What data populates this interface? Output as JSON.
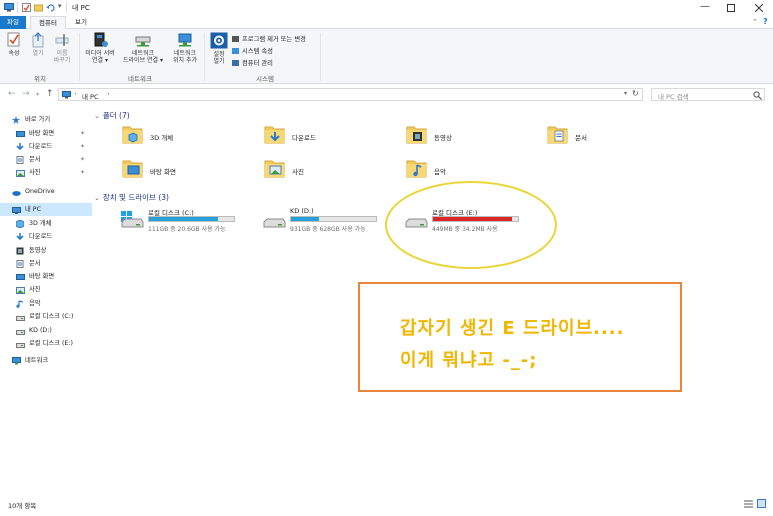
{
  "window": {
    "title": "내 PC",
    "controls": [
      "minimize",
      "maximize",
      "close"
    ]
  },
  "ribbon_tabs": [
    {
      "label": "파일",
      "active": true
    },
    {
      "label": "컴퓨터",
      "active": false
    },
    {
      "label": "보기",
      "active": false
    }
  ],
  "ribbon": {
    "location_group": {
      "label": "위치",
      "buttons": [
        {
          "label1": "속성",
          "label2": ""
        },
        {
          "label1": "열기",
          "label2": ""
        },
        {
          "label1": "이름",
          "label2": "바꾸기"
        }
      ]
    },
    "network_group": {
      "label": "네트워크",
      "buttons": [
        {
          "label1": "미디어 서버",
          "label2": "연결 ▾"
        },
        {
          "label1": "네트워크",
          "label2": "드라이브 연결 ▾"
        },
        {
          "label1": "네트워크",
          "label2": "위치 추가"
        }
      ]
    },
    "system_group": {
      "label": "시스템",
      "big_button": {
        "label1": "설정",
        "label2": "열기"
      },
      "items": [
        "프로그램 제거 또는 변경",
        "시스템 속성",
        "컴퓨터 관리"
      ]
    }
  },
  "address_bar": {
    "path": "내 PC",
    "separator": "›",
    "search_placeholder": "내 PC 검색"
  },
  "sidebar": {
    "items": [
      {
        "label": "바로 가기",
        "icon": "star-icon",
        "pinned": false
      },
      {
        "label": "바탕 화면",
        "icon": "desktop-icon",
        "pinned": true
      },
      {
        "label": "다운로드",
        "icon": "download-icon",
        "pinned": true
      },
      {
        "label": "문서",
        "icon": "document-icon",
        "pinned": true
      },
      {
        "label": "사진",
        "icon": "picture-icon",
        "pinned": true
      },
      {
        "label": "OneDrive",
        "icon": "cloud-icon",
        "pinned": false
      },
      {
        "label": "내 PC",
        "icon": "pc-icon",
        "pinned": false
      },
      {
        "label": "3D 개체",
        "icon": "cube-icon",
        "pinned": false
      },
      {
        "label": "다운로드",
        "icon": "download-icon",
        "pinned": false
      },
      {
        "label": "동영상",
        "icon": "video-icon",
        "pinned": false
      },
      {
        "label": "문서",
        "icon": "document-icon",
        "pinned": false
      },
      {
        "label": "바탕 화면",
        "icon": "desktop-icon",
        "pinned": false
      },
      {
        "label": "사진",
        "icon": "picture-icon",
        "pinned": false
      },
      {
        "label": "음악",
        "icon": "music-icon",
        "pinned": false
      },
      {
        "label": "로컬 디스크 (C:)",
        "icon": "drive-icon",
        "pinned": false
      },
      {
        "label": "KD (D:)",
        "icon": "drive-icon",
        "pinned": false
      },
      {
        "label": "로컬 디스크 (E:)",
        "icon": "drive-icon",
        "pinned": false
      },
      {
        "label": "네트워크",
        "icon": "network-icon",
        "pinned": false
      }
    ]
  },
  "folders_group": {
    "label": "폴더 (7)"
  },
  "folders": [
    {
      "name": "3D 개체",
      "icon": "cube-folder-icon"
    },
    {
      "name": "다운로드",
      "icon": "download-folder-icon"
    },
    {
      "name": "동영상",
      "icon": "video-folder-icon"
    },
    {
      "name": "문서",
      "icon": "document-folder-icon"
    },
    {
      "name": "바탕 화면",
      "icon": "desktop-folder-icon"
    },
    {
      "name": "사진",
      "icon": "picture-folder-icon"
    },
    {
      "name": "음악",
      "icon": "music-folder-icon"
    }
  ],
  "drives_group": {
    "label": "장치 및 드라이브 (3)"
  },
  "drives": [
    {
      "name": "로컬 디스크 (C:)",
      "size_text": "111GB 중 20.6GB 사용 가능",
      "used_fraction": 0.81,
      "bar_color": "#26a0da",
      "windows": true
    },
    {
      "name": "KD (D:)",
      "size_text": "931GB 중 628GB 사용 가능",
      "used_fraction": 0.33,
      "bar_color": "#26a0da",
      "windows": false
    },
    {
      "name": "로컬 디스크 (E:)",
      "size_text": "449MB 중 34.2MB 사용",
      "used_fraction": 0.93,
      "bar_color": "#da2626",
      "windows": false
    }
  ],
  "status_bar": {
    "text": "10개 항목"
  },
  "annotation": {
    "line1": "갑자기 생긴 E 드라이브....",
    "line2": "이게 뭐냐고 -_-;"
  },
  "colors": {
    "accent": "#1979ca",
    "annotation_text": "#f0b600",
    "annotation_border": "#e8853b",
    "highlight_ellipse": "#ebd535"
  }
}
